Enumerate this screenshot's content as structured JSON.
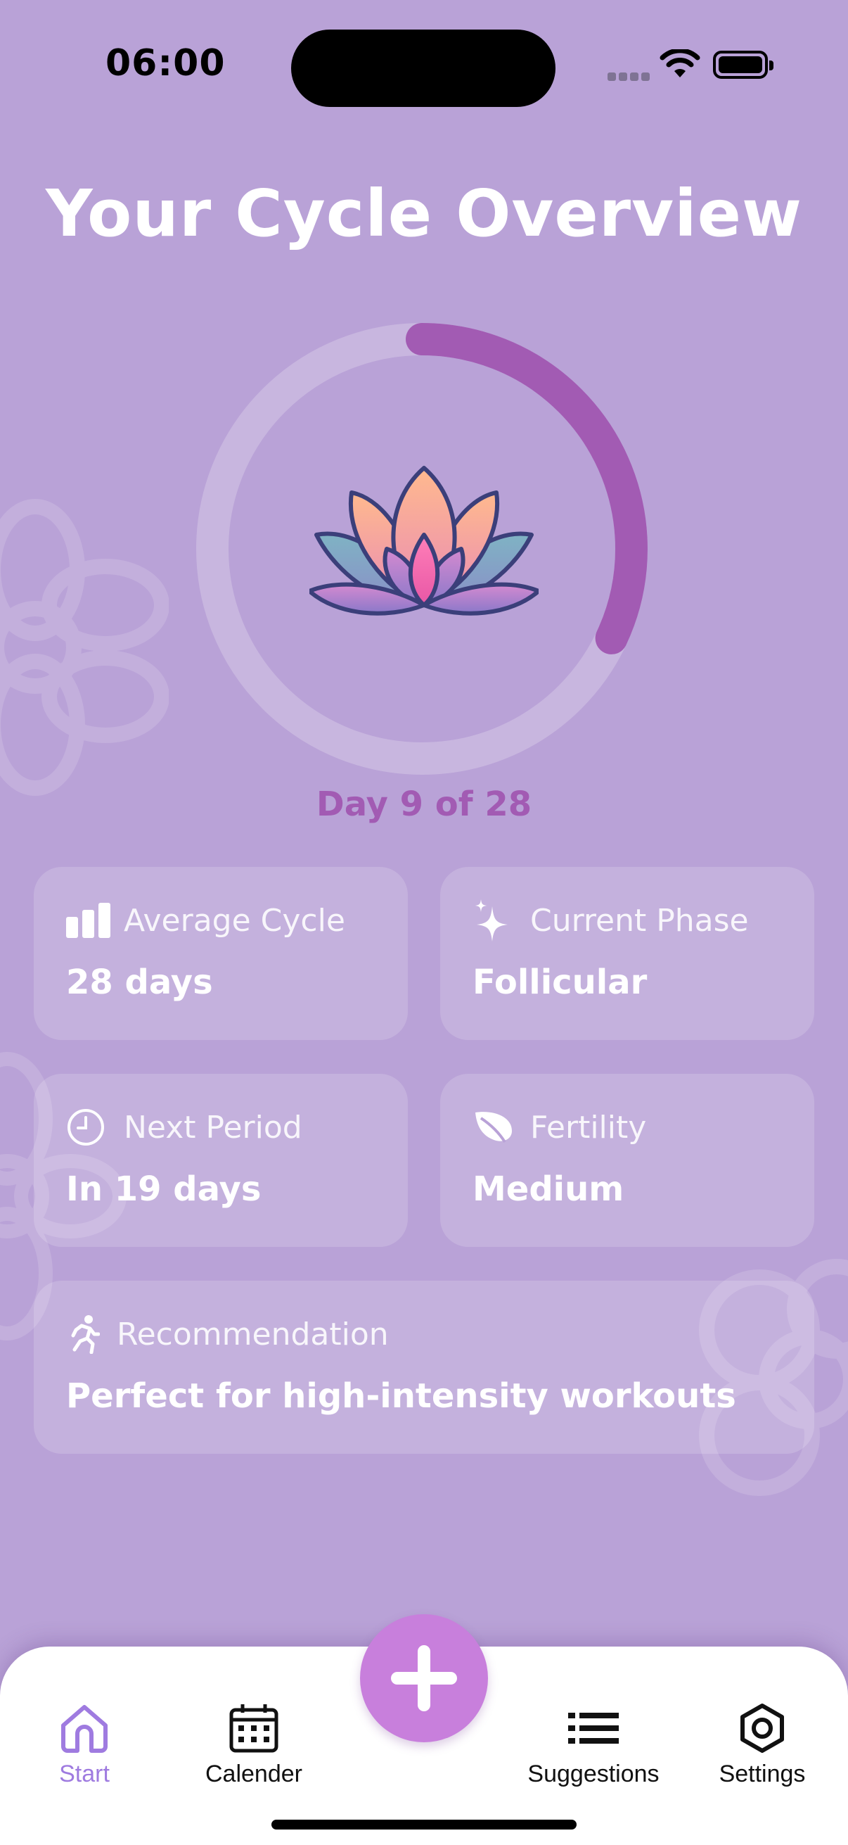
{
  "status_bar": {
    "time": "06:00"
  },
  "title": "Your Cycle Overview",
  "cycle": {
    "day_label": "Day 9 of 28",
    "current_day": 9,
    "total_days": 28,
    "progress": 0.32
  },
  "cards": {
    "average_cycle": {
      "label": "Average Cycle",
      "value": "28 days",
      "icon": "bar-chart-icon"
    },
    "current_phase": {
      "label": "Current Phase",
      "value": "Follicular",
      "icon": "sparkles-icon"
    },
    "next_period": {
      "label": "Next Period",
      "value": "In 19 days",
      "icon": "clock-icon"
    },
    "fertility": {
      "label": "Fertility",
      "value": "Medium",
      "icon": "leaf-icon"
    },
    "recommendation": {
      "label": "Recommendation",
      "value": "Perfect for high-intensity workouts",
      "icon": "running-icon"
    }
  },
  "tab_bar": {
    "active": "start",
    "tabs": [
      {
        "id": "start",
        "label": "Start",
        "icon": "home-icon"
      },
      {
        "id": "calendar",
        "label": "Calender",
        "icon": "calendar-icon"
      },
      {
        "id": "suggestions",
        "label": "Suggestions",
        "icon": "list-icon"
      },
      {
        "id": "settings",
        "label": "Settings",
        "icon": "gear-icon"
      }
    ],
    "fab_icon": "plus-icon"
  },
  "colors": {
    "background": "#b9a2d7",
    "ring_progress": "#a25bb3",
    "accent_tab": "#9f7be0",
    "fab": "#c87fdc"
  }
}
